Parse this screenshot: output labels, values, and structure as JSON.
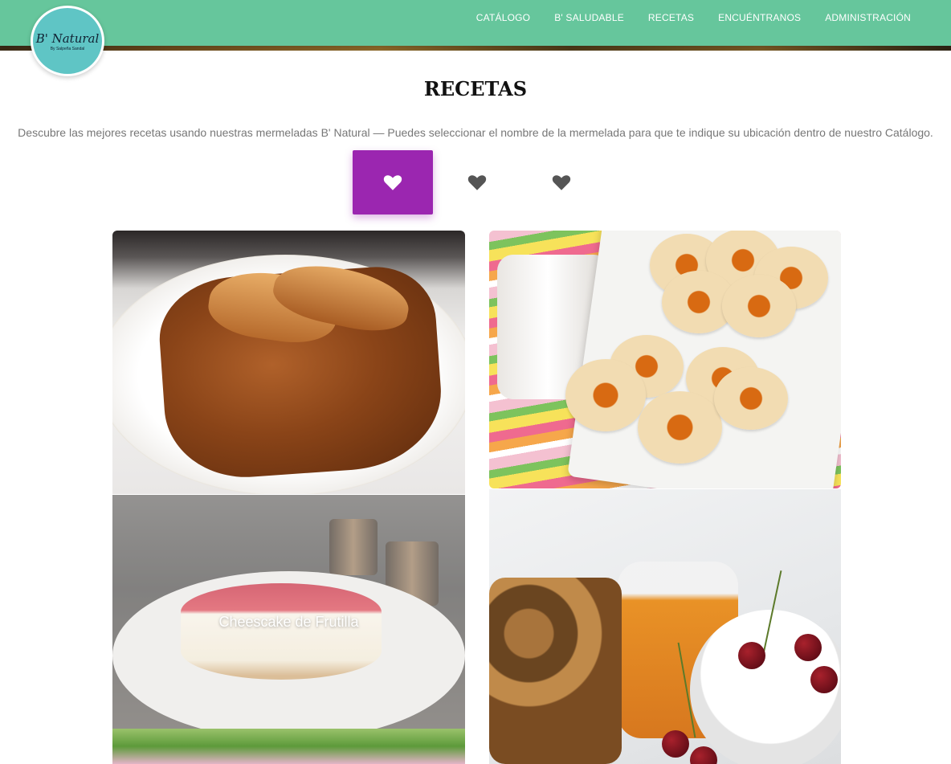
{
  "logo": {
    "main": "B' Natural",
    "sub": "By Salpeña Sandal"
  },
  "nav": {
    "items": [
      {
        "label": "CATÁLOGO"
      },
      {
        "label": "B' SALUDABLE"
      },
      {
        "label": "RECETAS"
      },
      {
        "label": "ENCUÉNTRANOS"
      },
      {
        "label": "ADMINISTRACIÓN"
      }
    ]
  },
  "page": {
    "title": "RECETAS",
    "description": "Descubre las mejores recetas usando nuestras mermeladas B' Natural — Puedes seleccionar el nombre de la mermelada para que te indique su ubicación dentro de nuestro Catálogo."
  },
  "filters": [
    {
      "icon": "heart-icon",
      "active": true
    },
    {
      "icon": "heart-icon",
      "active": false
    },
    {
      "icon": "heart-icon",
      "active": false
    }
  ],
  "recipes": {
    "cheesecake_label": "Cheescake de Frutilla"
  },
  "colors": {
    "nav_bg": "#66c69c",
    "accent": "#9b26b0",
    "logo_bg": "#5fc5c5"
  }
}
